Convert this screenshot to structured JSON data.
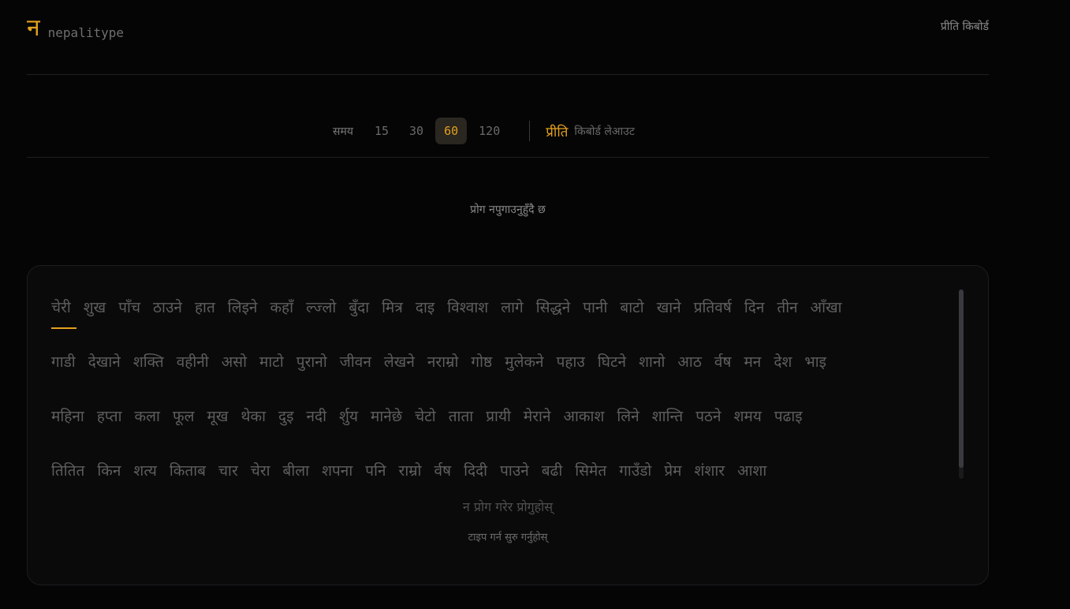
{
  "app": {
    "logo_mark": "न",
    "name": "nepalitype",
    "header_layout": "प्रीति किबोर्ड"
  },
  "config": {
    "time_label": "समय",
    "time_options": [
      "15",
      "30",
      "60",
      "120"
    ],
    "selected_time": "60",
    "layout_name": "प्रीति",
    "layout_sub": "किबोर्ड लेआउट"
  },
  "status": "प्रोग नपुगाउनुहुँदै छ",
  "words": {
    "lines": [
      [
        "चेरी",
        "शुख",
        "पाँच",
        "ठाउने",
        "हात",
        "लिइने",
        "कहाँ",
        "ल्ज्लो",
        "बुँदा",
        "मित्र",
        "दाइ",
        "विश्वाश",
        "लागे",
        "सिद्धने",
        "पानी",
        "बाटो",
        "खाने",
        "प्रतिवर्ष",
        "दिन",
        "तीन",
        "आँखा"
      ],
      [
        "गाडी",
        "देखाने",
        "शक्ति",
        "वहीनी",
        "असो",
        "माटो",
        "पुरानो",
        "जीवन",
        "लेखने",
        "नराम्रो",
        "गोष्ठ",
        "मुलेकने",
        "पहाउ",
        "घिटने",
        "शानो",
        "आठ",
        "र्वष",
        "मन",
        "देश",
        "भाइ"
      ],
      [
        "महिना",
        "हप्ता",
        "कला",
        "फूल",
        "मूख",
        "थेका",
        "दुइ",
        "नदी",
        "र्शुय",
        "मानेछे",
        "चेटो",
        "ताता",
        "प्रायी",
        "मेराने",
        "आकाश",
        "लिने",
        "शान्ति",
        "पठने",
        "शमय",
        "पढाइ"
      ],
      [
        "तितित",
        "किन",
        "शत्य",
        "किताब",
        "चार",
        "चेरा",
        "बीला",
        "शपना",
        "पनि",
        "राम्रो",
        "र्वष",
        "दिदी",
        "पाउने",
        "बढी",
        "सिमेत",
        "गाउँडो",
        "प्रेम",
        "शंशार",
        "आशा"
      ]
    ]
  },
  "hints": {
    "hint1": "न प्रोग गरेर प्रोगुहोस्",
    "hint2": "टाइप गर्न सुरु गर्नुहोस्"
  },
  "colors": {
    "accent": "#e3a11c",
    "background": "#050506"
  }
}
